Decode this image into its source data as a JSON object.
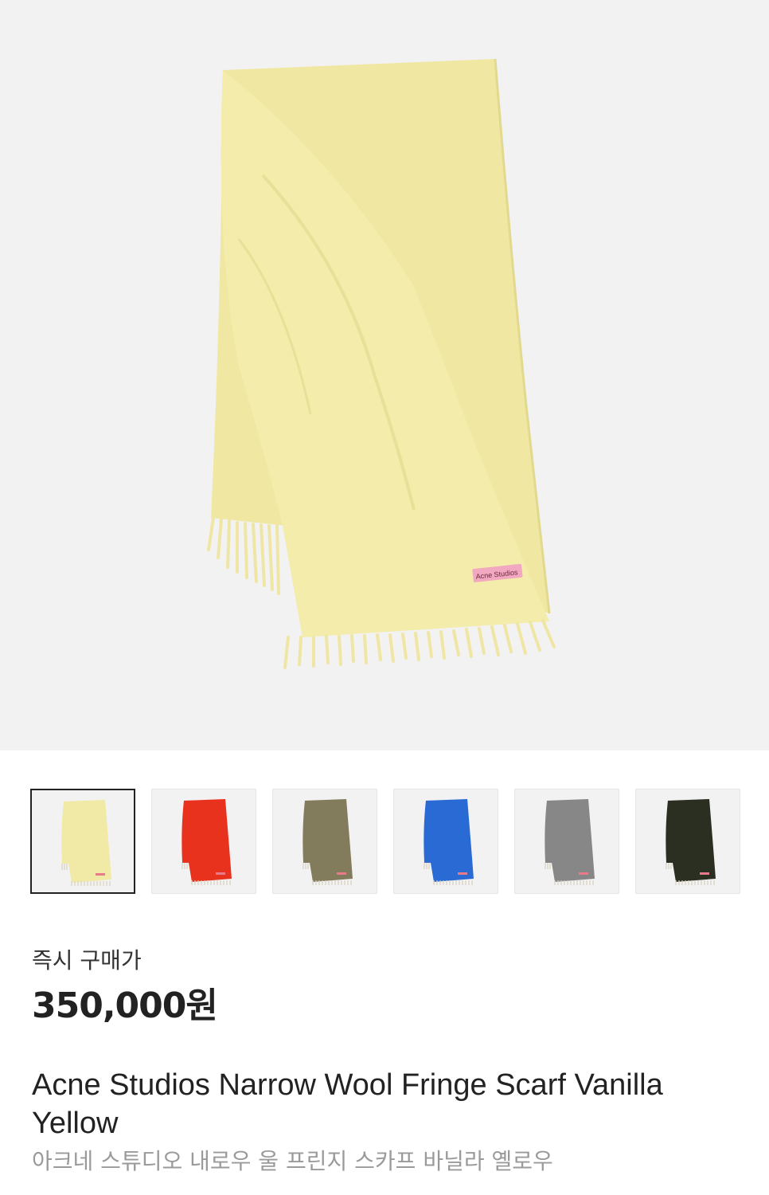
{
  "hero": {
    "image": "scarf-product-image",
    "brand_tag": "Acne Studios"
  },
  "thumbnails": [
    {
      "color": "#f1eaa6",
      "active": true
    },
    {
      "color": "#e8321e",
      "active": false
    },
    {
      "color": "#837c5c",
      "active": false
    },
    {
      "color": "#2a6ad4",
      "active": false
    },
    {
      "color": "#878787",
      "active": false
    },
    {
      "color": "#2b2f22",
      "active": false
    }
  ],
  "price": {
    "label": "즉시 구매가",
    "value": "350,000원"
  },
  "product": {
    "name_en": "Acne Studios Narrow Wool Fringe Scarf Vanilla Yellow",
    "name_ko": "아크네 스튜디오 내로우 울 프린지 스카프 바닐라 옐로우"
  }
}
